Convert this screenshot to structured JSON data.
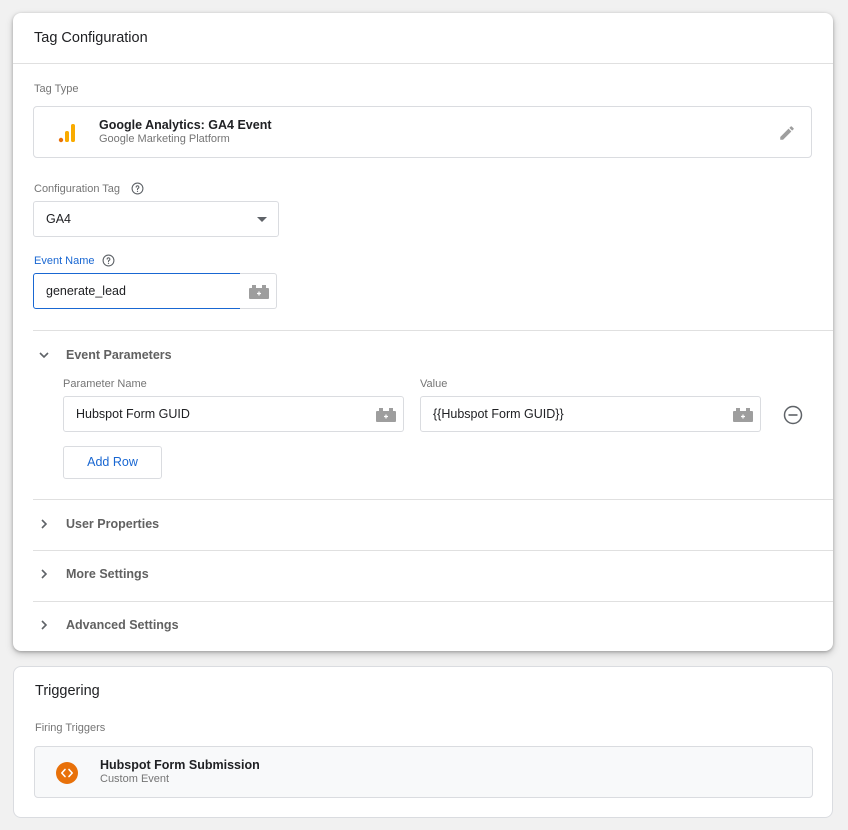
{
  "tag_config": {
    "title": "Tag Configuration",
    "tag_type_label": "Tag Type",
    "tag_type": {
      "name": "Google Analytics: GA4 Event",
      "provider": "Google Marketing Platform",
      "icon": "analytics-bars-icon",
      "icon_color": "#f9ab00"
    },
    "configuration_tag": {
      "label": "Configuration Tag",
      "value": "GA4"
    },
    "event_name": {
      "label": "Event Name",
      "value": "generate_lead"
    },
    "event_parameters": {
      "label": "Event Parameters",
      "expanded": true,
      "col_name_label": "Parameter Name",
      "col_value_label": "Value",
      "rows": [
        {
          "name": "Hubspot Form GUID",
          "value": "{{Hubspot Form GUID}}"
        }
      ],
      "add_row_label": "Add Row"
    },
    "collapsed_sections": [
      {
        "label": "User Properties"
      },
      {
        "label": "More Settings"
      },
      {
        "label": "Advanced Settings"
      }
    ]
  },
  "triggering": {
    "title": "Triggering",
    "firing_triggers_label": "Firing Triggers",
    "trigger": {
      "name": "Hubspot Form Submission",
      "type": "Custom Event",
      "icon": "code-brackets-icon",
      "icon_color": "#e8710a"
    }
  },
  "colors": {
    "accent": "#1967d2",
    "muted_text": "#757575"
  }
}
